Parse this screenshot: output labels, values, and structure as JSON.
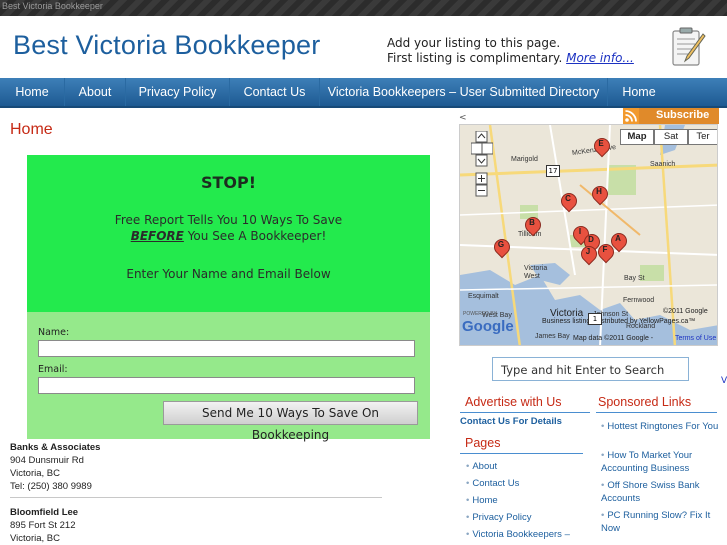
{
  "topbar": {
    "label": "Best Victoria Bookkeeper"
  },
  "header": {
    "site_title": "Best Victoria Bookkeeper",
    "promo_line1": "Add your listing to this page.",
    "promo_line2": "First listing is complimentary.",
    "promo_link": "More info..."
  },
  "nav": {
    "items": [
      {
        "label": "Home"
      },
      {
        "label": "About"
      },
      {
        "label": "Privacy Policy"
      },
      {
        "label": "Contact Us"
      },
      {
        "label": "Victoria Bookkeepers – User Submitted Directory"
      },
      {
        "label": "Home"
      }
    ]
  },
  "main": {
    "page_title": "Home",
    "stop_box": {
      "title": "STOP!",
      "line1": "Free Report Tells You 10 Ways To Save",
      "line2_em": "BEFORE",
      "line2_rest": " You See A Bookkeeper!",
      "line3": "Enter Your Name and Email Below"
    },
    "form": {
      "name_label": "Name:",
      "email_label": "Email:",
      "name_value": "",
      "email_value": "",
      "submit_label": "Send Me 10 Ways To Save On Bookkeeping"
    },
    "listings": [
      {
        "name": "Banks & Associates",
        "address": "904 Dunsmuir Rd",
        "city": "Victoria, BC",
        "phone": "Tel: (250) 380 9989"
      },
      {
        "name": "Bloomfield Lee",
        "address": "895 Fort St 212",
        "city": "Victoria, BC",
        "phone": ""
      }
    ]
  },
  "sidebar": {
    "subscribe_label": "Subscribe",
    "map": {
      "tabs": [
        "Map",
        "Sat",
        "Ter"
      ],
      "labels": {
        "marigold": "Marigold",
        "mckenzie": "McKenzie Ave",
        "saanich": "Saanich",
        "tillicum": "Tillicum",
        "victoria_west": "Victoria West",
        "bay_st": "Bay St",
        "esquimalt": "Esquimalt",
        "fernwood": "Fernwood",
        "west_bay": "West Bay",
        "victoria": "Victoria",
        "johnson_st": "Johnson St",
        "rockland": "Rockland",
        "james_bay": "James Bay",
        "copyright1": "©2011 Google",
        "business": "Business listings distributed by YellowPages.ca™",
        "copyright2": "Map data ©2011 Google -",
        "terms": "Terms of Use",
        "google": "Google",
        "powered": "POWERED BY"
      },
      "markers": [
        "E",
        "H",
        "C",
        "B",
        "I",
        "D",
        "A",
        "J",
        "F",
        "G"
      ],
      "highway_labels": [
        "17",
        "1"
      ]
    },
    "search_placeholder": "Type and hit Enter to Search",
    "advertise": {
      "title": "Advertise with Us",
      "link": "Contact Us For Details"
    },
    "pages": {
      "title": "Pages",
      "items": [
        "About",
        "Contact Us",
        "Home",
        "Privacy Policy",
        "Victoria Bookkeepers –"
      ]
    },
    "sponsored": {
      "title": "Sponsored Links",
      "items": [
        "Hottest Ringtones For You",
        "How To Market Your Accounting Business",
        "Off Shore Swiss Bank Accounts",
        "PC Running Slow? Fix It Now"
      ]
    },
    "left_arrow": "<",
    "right_marker": "V"
  }
}
